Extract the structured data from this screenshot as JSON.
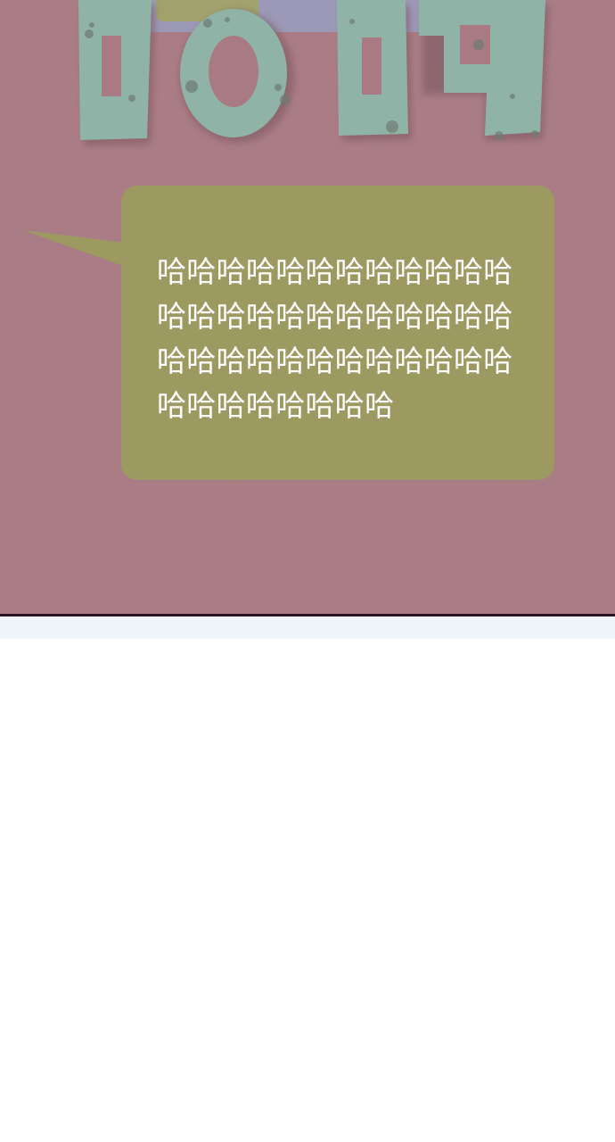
{
  "panel": {
    "background_color": "#a97a83",
    "title_glyph_color": "#8fb6a8",
    "title_band_colors": [
      "#a2a36c",
      "#9a99c6"
    ]
  },
  "speech_bubble": {
    "fill_color": "#9d9a61",
    "text": "哈哈哈哈哈哈哈哈哈哈哈哈哈哈哈哈哈哈哈哈哈哈哈哈哈哈哈哈哈哈哈哈哈哈哈哈哈哈哈哈哈哈哈哈"
  }
}
